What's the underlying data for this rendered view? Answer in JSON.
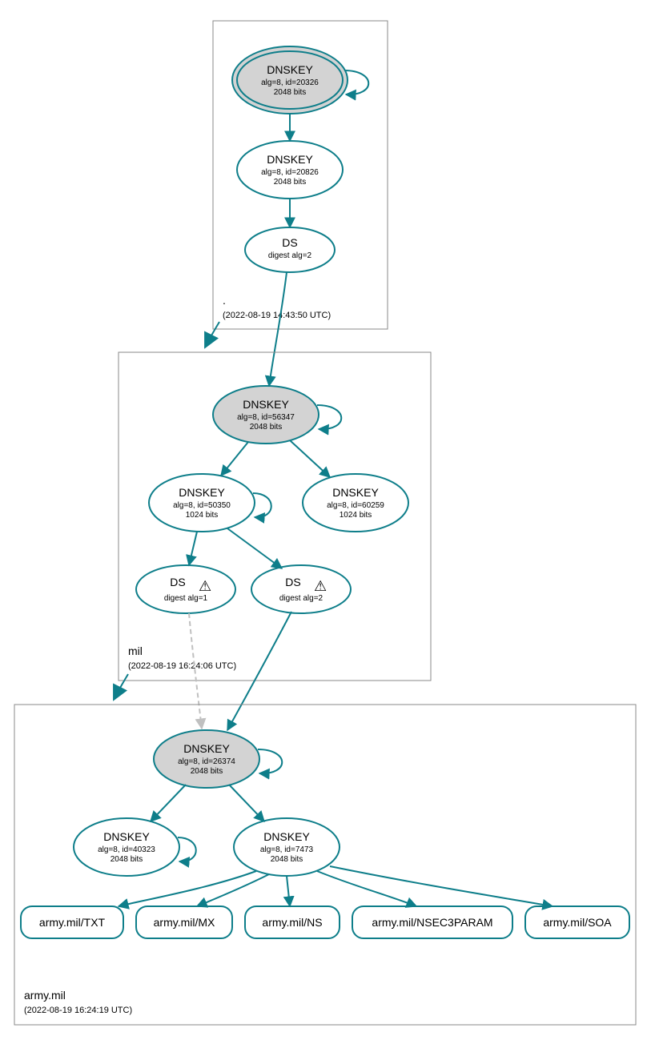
{
  "colors": {
    "accent": "#0e7e8a",
    "ksk_fill": "#d3d3d3"
  },
  "zones": {
    "root": {
      "label": ".",
      "timestamp": "(2022-08-19 14:43:50 UTC)",
      "nodes": {
        "ksk": {
          "title": "DNSKEY",
          "sub1": "alg=8, id=20326",
          "sub2": "2048 bits"
        },
        "zsk": {
          "title": "DNSKEY",
          "sub1": "alg=8, id=20826",
          "sub2": "2048 bits"
        },
        "ds": {
          "title": "DS",
          "sub1": "digest alg=2"
        }
      }
    },
    "mil": {
      "label": "mil",
      "timestamp": "(2022-08-19 16:24:06 UTC)",
      "nodes": {
        "ksk": {
          "title": "DNSKEY",
          "sub1": "alg=8, id=56347",
          "sub2": "2048 bits"
        },
        "zsk1": {
          "title": "DNSKEY",
          "sub1": "alg=8, id=50350",
          "sub2": "1024 bits"
        },
        "zsk2": {
          "title": "DNSKEY",
          "sub1": "alg=8, id=60259",
          "sub2": "1024 bits"
        },
        "ds1": {
          "title": "DS",
          "sub1": "digest alg=1",
          "warn": "⚠"
        },
        "ds2": {
          "title": "DS",
          "sub1": "digest alg=2",
          "warn": "⚠"
        }
      }
    },
    "army": {
      "label": "army.mil",
      "timestamp": "(2022-08-19 16:24:19 UTC)",
      "nodes": {
        "ksk": {
          "title": "DNSKEY",
          "sub1": "alg=8, id=26374",
          "sub2": "2048 bits"
        },
        "zsk1": {
          "title": "DNSKEY",
          "sub1": "alg=8, id=40323",
          "sub2": "2048 bits"
        },
        "zsk2": {
          "title": "DNSKEY",
          "sub1": "alg=8, id=7473",
          "sub2": "2048 bits"
        }
      },
      "rrsets": {
        "txt": "army.mil/TXT",
        "mx": "army.mil/MX",
        "ns": "army.mil/NS",
        "nsec": "army.mil/NSEC3PARAM",
        "soa": "army.mil/SOA"
      }
    }
  }
}
